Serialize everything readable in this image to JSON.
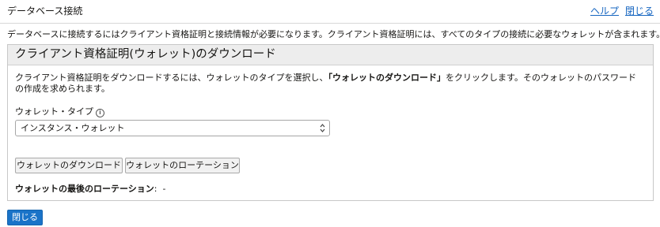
{
  "header": {
    "title": "データベース接続",
    "help_link": "ヘルプ",
    "close_link": "閉じる"
  },
  "intro": "データベースに接続するにはクライアント資格証明と接続情報が必要になります。クライアント資格証明には、すべてのタイプの接続に必要なウォレットが含まれます。",
  "section": {
    "title": "クライアント資格証明(ウォレット)のダウンロード",
    "desc_before": "クライアント資格証明をダウンロードするには、ウォレットのタイプを選択し、",
    "desc_bold": "「ウォレットのダウンロード」",
    "desc_after": "をクリックします。そのウォレットのパスワードの作成を求められます。",
    "wallet_type_label": "ウォレット・タイプ",
    "info_glyph": "i",
    "wallet_type_value": "インスタンス・ウォレット",
    "download_button": "ウォレットのダウンロード",
    "rotate_button": "ウォレットのローテーション",
    "last_rotation_label": "ウォレットの最後のローテーション",
    "last_rotation_sep": ":",
    "last_rotation_value": "-"
  },
  "footer": {
    "close_button": "閉じる"
  }
}
